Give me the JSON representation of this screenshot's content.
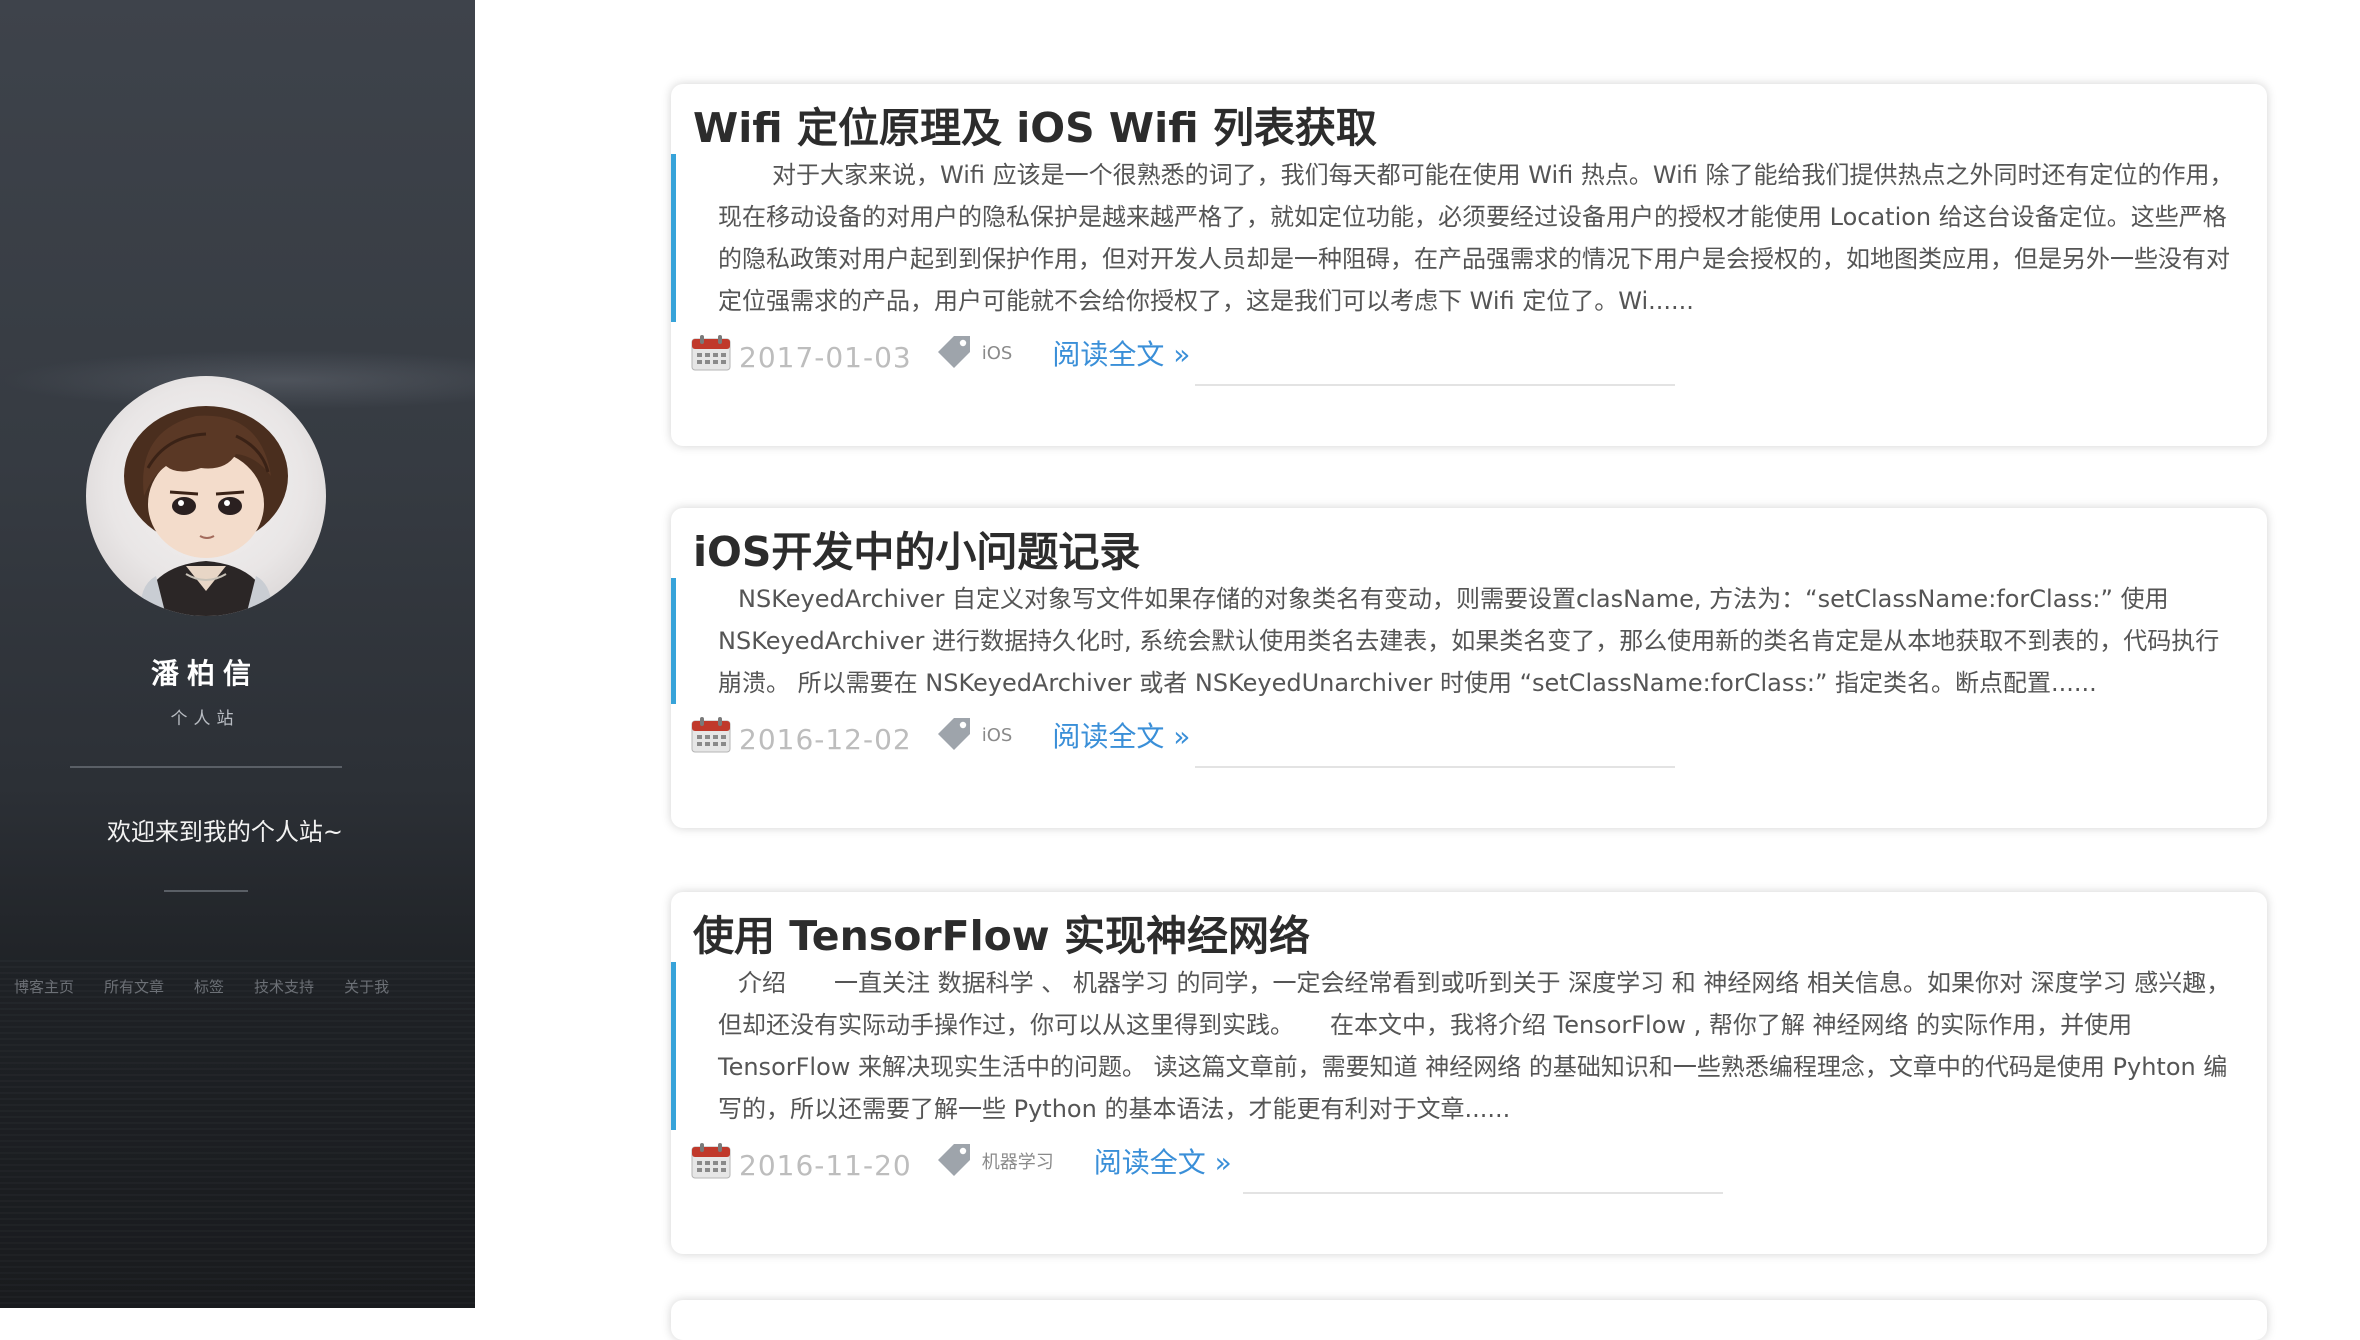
{
  "sidebar": {
    "owner_name": "潘柏信",
    "owner_subtitle": "个人站",
    "welcome": "欢迎来到我的个人站~",
    "nav": [
      "博客主页",
      "所有文章",
      "标签",
      "技术支持",
      "关于我"
    ]
  },
  "posts": [
    {
      "title": "Wifi 定位原理及 iOS Wifi 列表获取",
      "excerpt": "对于大家来说，Wifi 应该是一个很熟悉的词了，我们每天都可能在使用 Wifi 热点。Wifi 除了能给我们提供热点之外同时还有定位的作用， 现在移动设备的对用户的隐私保护是越来越严格了，就如定位功能，必须要经过设备用户的授权才能使用 Location 给这台设备定位。这些严格的隐私政策对用户起到到保护作用，但对开发人员却是一种阻碍，在产品强需求的情况下用户是会授权的，如地图类应用，但是另外一些没有对定位强需求的产品，用户可能就不会给你授权了，这是我们可以考虑下 Wifi 定位了。Wi......",
      "date": "2017-01-03",
      "tag": "iOS",
      "read_more": "阅读全文 »"
    },
    {
      "title": "iOS开发中的小问题记录",
      "excerpt": "NSKeyedArchiver 自定义对象写文件如果存储的对象类名有变动，则需要设置clasName, 方法为：“setClassName:forClass:” 使用 NSKeyedArchiver 进行数据持久化时, 系统会默认使用类名去建表，如果类名变了，那么使用新的类名肯定是从本地获取不到表的，代码执行崩溃。 所以需要在 NSKeyedArchiver 或者 NSKeyedUnarchiver 时使用 “setClassName:forClass:” 指定类名。断点配置......",
      "date": "2016-12-02",
      "tag": "iOS",
      "read_more": "阅读全文 »"
    },
    {
      "title": "使用 TensorFlow 实现神经网络",
      "excerpt": "介绍　　一直关注 数据科学 、 机器学习 的同学，一定会经常看到或听到关于 深度学习 和 神经网络 相关信息。如果你对 深度学习 感兴趣，但却还没有实际动手操作过，你可以从这里得到实践。　　在本文中，我将介绍 TensorFlow , 帮你了解 神经网络 的实际作用，并使用 TensorFlow 来解决现实生活中的问题。 读这篇文章前，需要知道 神经网络 的基础知识和一些熟悉编程理念，文章中的代码是使用 Pyhton 编写的，所以还需要了解一些 Python 的基本语法，才能更有利对于文章......",
      "date": "2016-11-20",
      "tag": "机器学习",
      "read_more": "阅读全文 »"
    }
  ],
  "icons": {
    "calendar": "calendar-icon",
    "tag": "tag-icon"
  },
  "colors": {
    "accent_border": "#37a3d9",
    "link": "#3a8fd8",
    "date": "#bdbdbd",
    "calendar_top": "#c0392b"
  }
}
